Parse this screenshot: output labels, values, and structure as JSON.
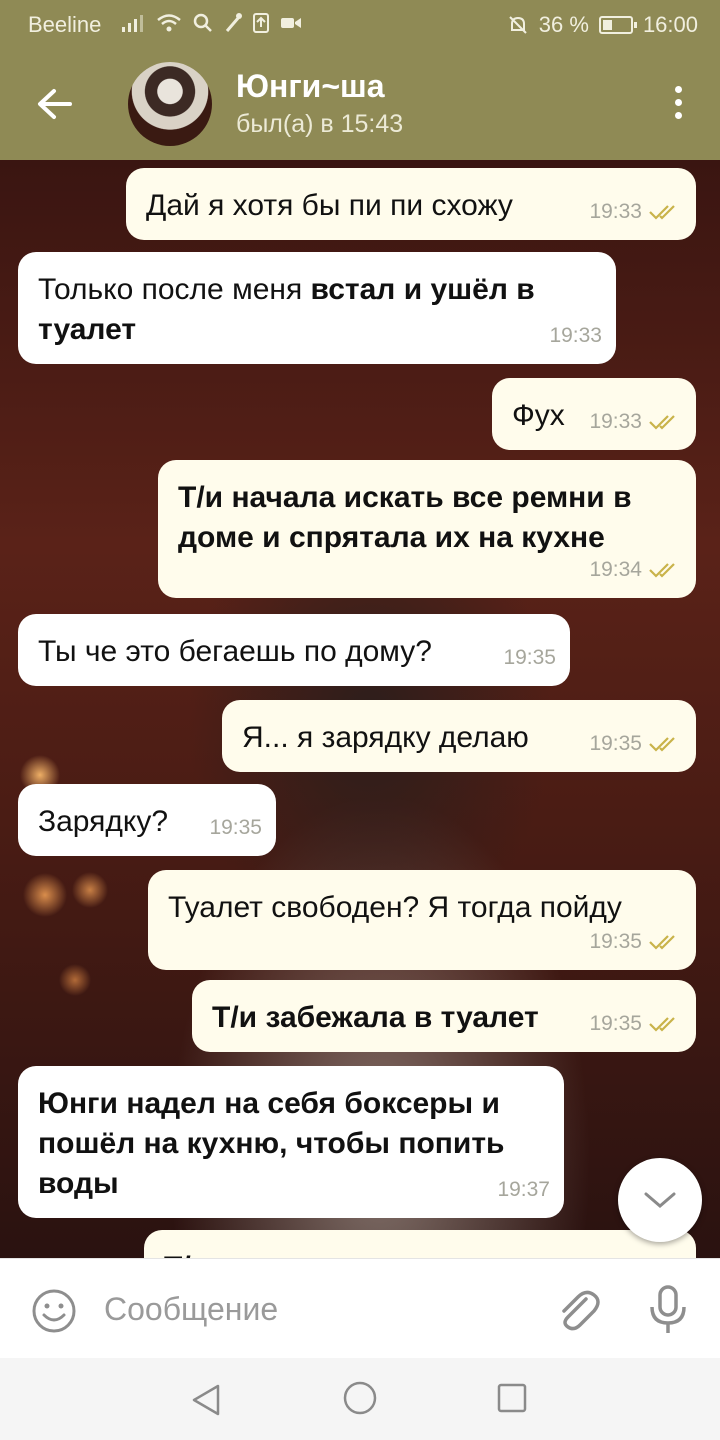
{
  "status_bar": {
    "carrier": "Beeline",
    "battery_text": "36 %",
    "battery_level": 0.36,
    "time": "16:00"
  },
  "header": {
    "contact_name": "Юнги~ша",
    "contact_status": "был(а) в 15:43"
  },
  "messages": [
    {
      "direction": "out",
      "text": "Дай я хотя бы пи пи схожу",
      "time": "19:33",
      "read": true
    },
    {
      "direction": "in",
      "text_plain": "Только после меня ",
      "text_bold": "встал и ушёл в туалет",
      "time": "19:33"
    },
    {
      "direction": "out",
      "text": "Фух",
      "time": "19:33",
      "read": true
    },
    {
      "direction": "out",
      "text_bold": "Т/и начала искать все ремни в доме и спрятала их на кухне",
      "time": "19:34",
      "read": true
    },
    {
      "direction": "in",
      "text": "Ты че это бегаешь по дому?",
      "time": "19:35"
    },
    {
      "direction": "out",
      "text": "Я... я зарядку делаю",
      "time": "19:35",
      "read": true
    },
    {
      "direction": "in",
      "text": "Зарядку?",
      "time": "19:35"
    },
    {
      "direction": "out",
      "text": "Туалет свободен? Я тогда пойду",
      "time": "19:35",
      "read": true
    },
    {
      "direction": "out",
      "text_bold": "Т/и забежала в туалет",
      "time": "19:35",
      "read": true
    },
    {
      "direction": "in",
      "text_bold": "Юнги надел на себя боксеры и пошёл на кухню, чтобы попить воды",
      "time": "19:37"
    },
    {
      "direction": "out",
      "text_bold": "Т/",
      "time": "",
      "read": false
    }
  ],
  "input": {
    "placeholder": "Сообщение"
  },
  "colors": {
    "header_bg": "#8f8a55",
    "outgoing_bubble": "#fffcec",
    "incoming_bubble": "#ffffff",
    "read_ticks": "#c9b34a"
  },
  "icons": [
    "back-arrow-icon",
    "more-vert-icon",
    "read-ticks-icon",
    "chevron-down-icon",
    "emoji-icon",
    "paperclip-icon",
    "microphone-icon",
    "nav-back-icon",
    "nav-home-icon",
    "nav-recent-icon"
  ]
}
